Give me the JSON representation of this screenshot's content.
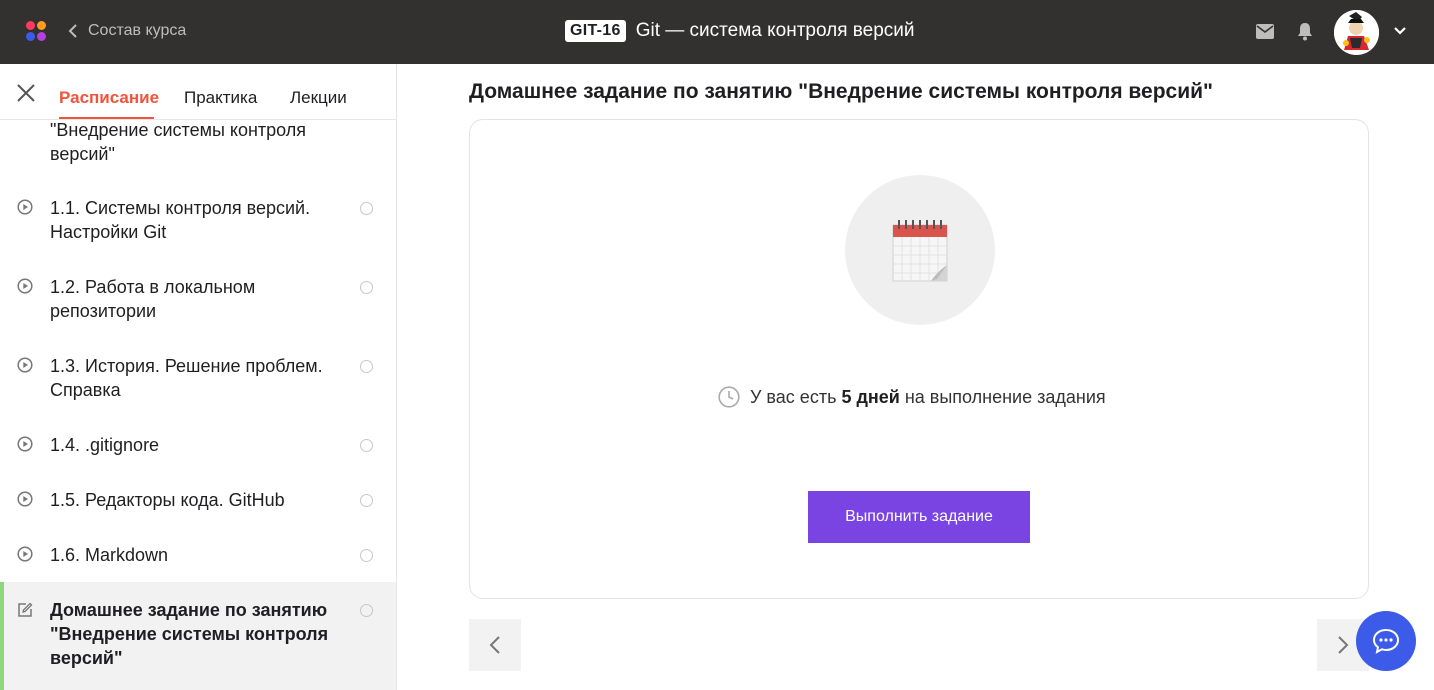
{
  "header": {
    "back_label": "Состав курса",
    "course_code": "GIT-16",
    "course_name": "Git — система контроля версий"
  },
  "sidebar": {
    "tabs": [
      {
        "label": "Расписание",
        "active": true
      },
      {
        "label": "Практика",
        "active": false
      },
      {
        "label": "Лекции",
        "active": false
      }
    ],
    "items": [
      {
        "label": "\"Внедрение системы контроля версий\"",
        "icon": "none",
        "partial": true
      },
      {
        "label": "1.1. Системы контроля версий. Настройки Git",
        "icon": "play-circle-icon"
      },
      {
        "label": "1.2. Работа в локальном репозитории",
        "icon": "play-circle-icon"
      },
      {
        "label": "1.3. История. Решение проблем. Справка",
        "icon": "play-circle-icon"
      },
      {
        "label": "1.4. .gitignore",
        "icon": "play-circle-icon"
      },
      {
        "label": "1.5. Редакторы кода. GitHub",
        "icon": "play-circle-icon"
      },
      {
        "label": "1.6. Markdown",
        "icon": "play-circle-icon"
      },
      {
        "label": "Домашнее задание по занятию \"Внедрение системы контроля версий\"",
        "icon": "edit-icon",
        "current": true
      }
    ]
  },
  "main": {
    "title": "Домашнее задание по занятию \"Внедрение системы контроля версий\"",
    "deadline_prefix": "У вас есть",
    "deadline_value": "5 дней",
    "deadline_suffix": "на выполнение задания",
    "button_label": "Выполнить задание"
  },
  "colors": {
    "topbar": "#333030",
    "accent_tab": "#f0553c",
    "button": "#7a44e2",
    "chat": "#3c5be8",
    "current_marker": "#8cd87d"
  },
  "icons": [
    "logo-icon",
    "chevron-left-icon",
    "mail-icon",
    "bell-icon",
    "chevron-down-icon",
    "close-icon",
    "play-circle-icon",
    "edit-icon",
    "calendar-icon",
    "clock-icon",
    "chevron-right-icon",
    "chat-icon"
  ]
}
